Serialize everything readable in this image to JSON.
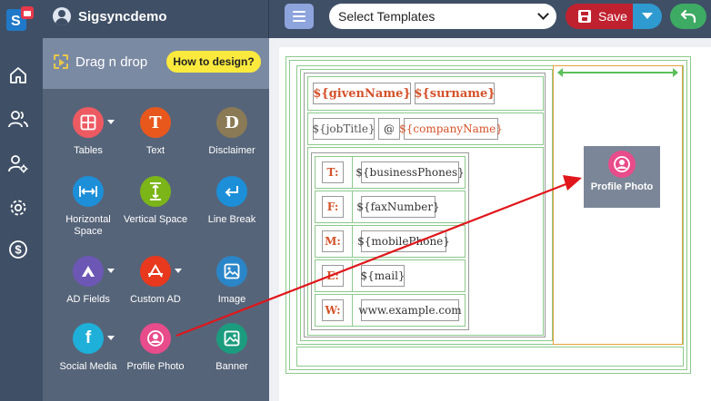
{
  "app": {
    "user_name": "Sigsyncdemo"
  },
  "toolbar": {
    "template_select": "Select Templates",
    "save_label": "Save"
  },
  "panel": {
    "title": "Drag n drop",
    "how_to": "How to design?",
    "tools": [
      {
        "label": "Tables",
        "glyph": "",
        "color": "#ee5a62"
      },
      {
        "label": "Text",
        "glyph": "T",
        "color": "#e8581d"
      },
      {
        "label": "Disclaimer",
        "glyph": "D",
        "color": "#8a7a55"
      },
      {
        "label": "Horizontal Space",
        "glyph": "",
        "color": "#1c8fd8"
      },
      {
        "label": "Vertical Space",
        "glyph": "",
        "color": "#7cb518"
      },
      {
        "label": "Line Break",
        "glyph": "",
        "color": "#1c8fd8"
      },
      {
        "label": "AD Fields",
        "glyph": "",
        "color": "#6c57b5"
      },
      {
        "label": "Custom AD",
        "glyph": "",
        "color": "#e8381d"
      },
      {
        "label": "Image",
        "glyph": "",
        "color": "#2a86c8"
      },
      {
        "label": "Social Media",
        "glyph": "f",
        "color": "#1eb0d8"
      },
      {
        "label": "Profile Photo",
        "glyph": "",
        "color": "#e84c8b"
      },
      {
        "label": "Banner",
        "glyph": "",
        "color": "#1c9c7e"
      }
    ]
  },
  "signature": {
    "given_name": "${givenName}",
    "surname": "${surname}",
    "job_title": "${jobTitle}",
    "at": "@",
    "company_name": "${companyName}",
    "rows": [
      {
        "key": "T:",
        "value": "${businessPhones}"
      },
      {
        "key": "F:",
        "value": "${faxNumber}"
      },
      {
        "key": "M:",
        "value": "${mobilePhone}"
      },
      {
        "key": "E:",
        "value": "${mail}"
      },
      {
        "key": "W:",
        "value": "www.example.com"
      }
    ],
    "profile_photo_label": "Profile Photo"
  },
  "colors": {
    "topbar": "#3f4f66",
    "save": "#c0212f",
    "save_dropdown": "#2e9ad0",
    "undo": "#3dab63",
    "accent_orange": "#d4522a",
    "arrow": "#e0161b",
    "table_border": "#8cc98c"
  }
}
